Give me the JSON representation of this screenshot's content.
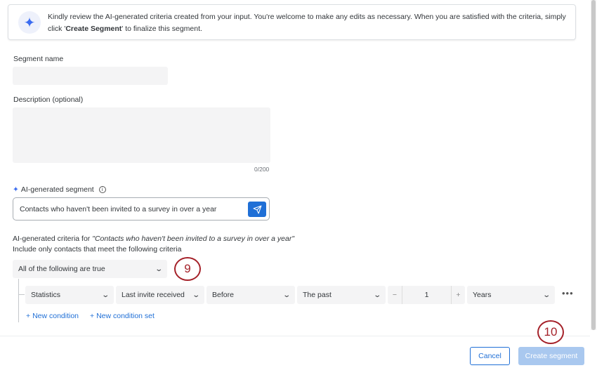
{
  "banner": {
    "icon": "sparkle-icon",
    "text_before": "Kindly review the AI-generated criteria created from your input. You're welcome to make any edits as necessary. When you are satisfied with the criteria, simply click '",
    "text_bold": "Create Segment",
    "text_after": "' to finalize this segment."
  },
  "form": {
    "segment_name_label": "Segment name",
    "segment_name_value": "",
    "description_label": "Description (optional)",
    "description_value": "",
    "char_count": "0/200",
    "ai_label": "AI-generated segment",
    "ai_value": "Contacts who haven't been invited to a survey in over a year"
  },
  "criteria": {
    "title_prefix": "AI-generated criteria for ",
    "title_query": "\"Contacts who haven't been invited to a survey in over a year\"",
    "subtitle": "Include only contacts that meet the following criteria",
    "logic": "All of the following are true",
    "condition": {
      "field_type": "Statistics",
      "field": "Last invite received",
      "operator": "Before",
      "range": "The past",
      "amount": "1",
      "unit": "Years"
    },
    "new_condition": "New condition",
    "new_condition_set": "New condition set"
  },
  "annotations": {
    "step9": "9",
    "step10": "10"
  },
  "footer": {
    "cancel": "Cancel",
    "create": "Create segment"
  },
  "colors": {
    "accent": "#1f6fd6",
    "annotation": "#a5222a",
    "disabled": "#a9c8ef"
  }
}
